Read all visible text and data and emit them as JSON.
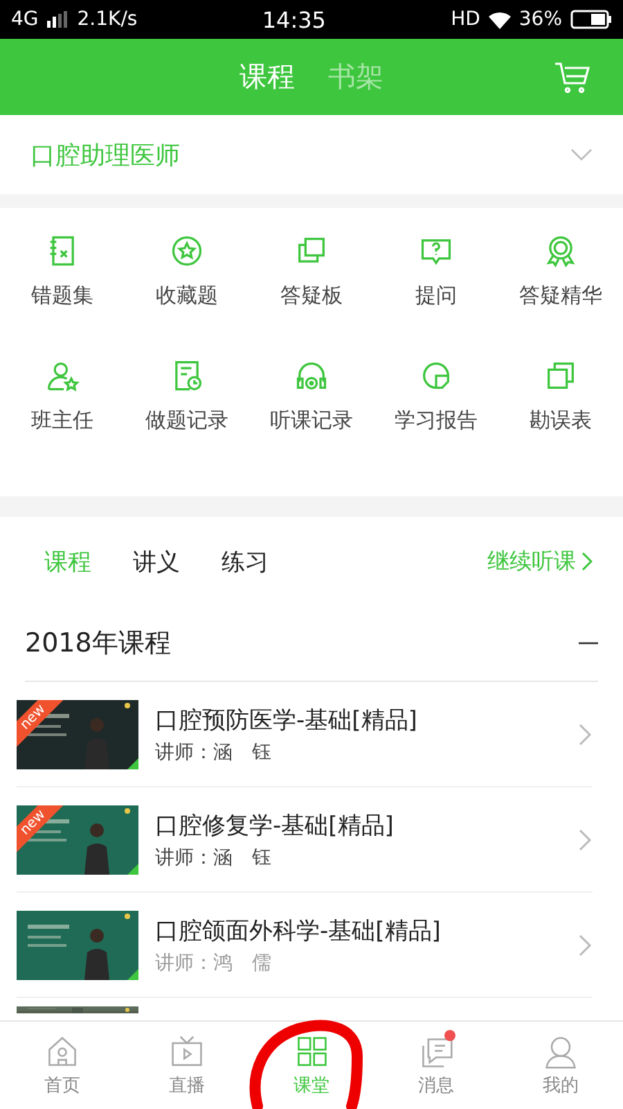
{
  "status_bar": {
    "network": "4G",
    "speed": "2.1K/s",
    "time": "14:35",
    "hd": "HD",
    "battery": "36%"
  },
  "header": {
    "tabs": [
      {
        "label": "课程",
        "selected": true
      },
      {
        "label": "书架",
        "selected": false
      }
    ]
  },
  "subject": {
    "label": "口腔助理医师"
  },
  "tools": [
    {
      "label": "错题集"
    },
    {
      "label": "收藏题"
    },
    {
      "label": "答疑板"
    },
    {
      "label": "提问"
    },
    {
      "label": "答疑精华"
    },
    {
      "label": "班主任"
    },
    {
      "label": "做题记录"
    },
    {
      "label": "听课记录"
    },
    {
      "label": "学习报告"
    },
    {
      "label": "勘误表"
    }
  ],
  "content_tabs": [
    {
      "label": "课程",
      "selected": true
    },
    {
      "label": "讲义",
      "selected": false
    },
    {
      "label": "练习",
      "selected": false
    }
  ],
  "continue_link": "继续听课",
  "section": {
    "title": "2018年课程",
    "expanded": true
  },
  "courses": [
    {
      "title": "口腔预防医学-基础[精品]",
      "teacher": "讲师：涵　钰",
      "badge": "new",
      "kind": "picture"
    },
    {
      "title": "口腔修复学-基础[精品]",
      "teacher": "讲师：涵　钰",
      "badge": "new",
      "kind": "picture"
    },
    {
      "title": "口腔颌面外科学-基础[精品]",
      "teacher": "讲师：鸿　儒",
      "kind": "picture"
    },
    {
      "kind": "picture"
    }
  ],
  "nav": [
    {
      "label": "首页",
      "selected": false
    },
    {
      "label": "直播",
      "selected": false
    },
    {
      "label": "课堂",
      "selected": true
    },
    {
      "label": "消息",
      "selected": false,
      "dot": true
    },
    {
      "label": "我的",
      "selected": false
    }
  ]
}
